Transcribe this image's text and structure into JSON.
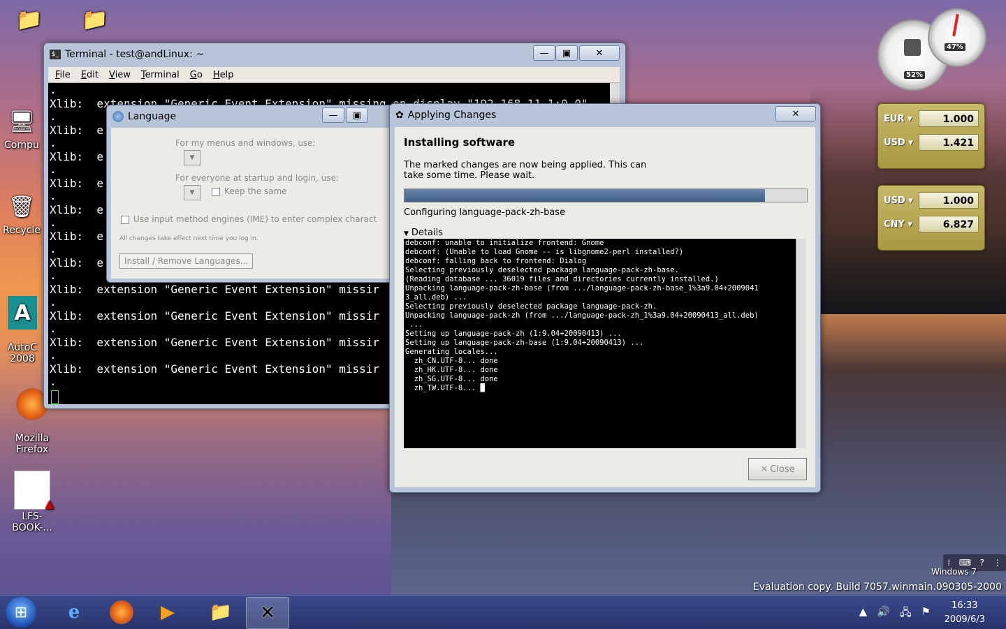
{
  "desktop": {
    "icons": [
      {
        "label": ""
      },
      {
        "label": ""
      },
      {
        "label": "Compu"
      },
      {
        "label": "Recycle"
      },
      {
        "label": "AutoC\n2008"
      },
      {
        "label": "Mozilla\nFirefox"
      },
      {
        "label": "LFS-BOOK-..."
      }
    ],
    "watermark_brand": "Windows 7",
    "watermark_eval": "Evaluation copy. Build 7057.winmain.090305-2000"
  },
  "terminal": {
    "title": "Terminal - test@andLinux: ~",
    "menu": [
      "File",
      "Edit",
      "View",
      "Terminal",
      "Go",
      "Help"
    ],
    "lines": [
      "Xlib:  extension \"Generic Event Extension\" missing on display \"192.168.11.1:0.0\"",
      "Xlib:  e",
      "Xlib:  e",
      "Xlib:  e",
      "Xlib:  e",
      "Xlib:  e",
      "Xlib:  e",
      "Xlib:  extension \"Generic Event Extension\" missir",
      "Xlib:  extension \"Generic Event Extension\" missir",
      "Xlib:  extension \"Generic Event Extension\" missir",
      "Xlib:  extension \"Generic Event Extension\" missir"
    ]
  },
  "language": {
    "title": "Language",
    "menus_label": "For my menus and windows, use:",
    "startup_label": "For everyone at startup and login, use:",
    "keep_same": "Keep the same",
    "ime_label": "Use input method engines (IME) to enter complex charact",
    "note": "All changes take effect next time you log in.",
    "install_button": "Install / Remove Languages..."
  },
  "apply": {
    "title": "Applying Changes",
    "heading": "Installing software",
    "message_1": "The marked changes are now being applied. This can",
    "message_2": "take some time. Please wait.",
    "progress": 0.895,
    "status": "Configuring language-pack-zh-base",
    "details_label": "Details",
    "log": [
      "debconf: unable to initialize frontend: Gnome",
      "debconf: (Unable to load Gnome -- is libgnome2-perl installed?)",
      "debconf: falling back to frontend: Dialog",
      "Selecting previously deselected package language-pack-zh-base.",
      "(Reading database ... 36019 files and directories currently installed.)",
      "Unpacking language-pack-zh-base (from .../language-pack-zh-base_1%3a9.04+2009041",
      "3_all.deb) ...",
      "Selecting previously deselected package language-pack-zh.",
      "Unpacking language-pack-zh (from .../language-pack-zh_1%3a9.04+20090413_all.deb)",
      " ...",
      "Setting up language-pack-zh (1:9.04+20090413) ...",
      "Setting up language-pack-zh-base (1:9.04+20090413) ...",
      "Generating locales...",
      "  zh_CN.UTF-8... done",
      "  zh_HK.UTF-8... done",
      "  zh_SG.UTF-8... done",
      "  zh_TW.UTF-8... █"
    ],
    "close_label": "Close"
  },
  "gadgets": {
    "cpu_percent": "52%",
    "mem_percent": "47%",
    "fx1": [
      {
        "cur": "EUR",
        "val": "1.000"
      },
      {
        "cur": "USD",
        "val": "1.421"
      }
    ],
    "fx2": [
      {
        "cur": "USD",
        "val": "1.000"
      },
      {
        "cur": "CNY",
        "val": "6.827"
      }
    ]
  },
  "taskbar": {
    "time": "16:33",
    "date": "2009/6/3"
  }
}
